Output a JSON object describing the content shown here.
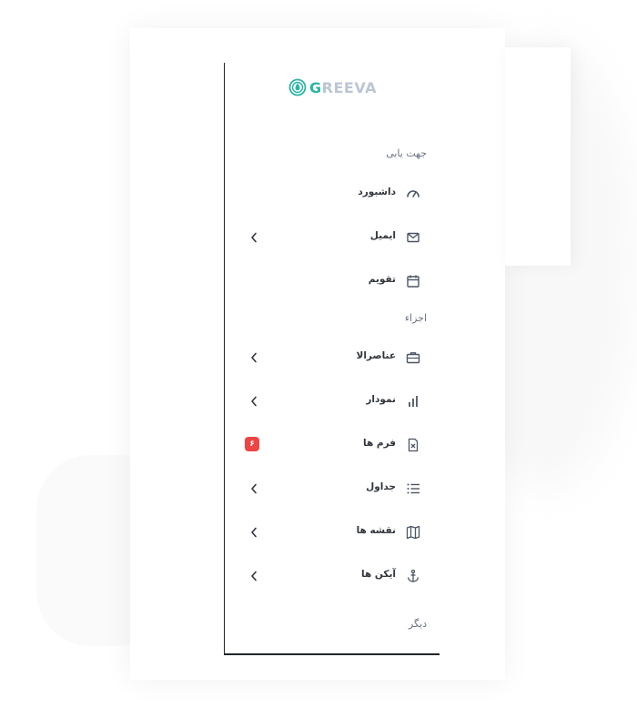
{
  "brand": {
    "name_first_letter": "G",
    "name_rest": "REEVA",
    "accent_color": "#2bb5a6",
    "muted_color": "#bcc6d3"
  },
  "sections": {
    "navigation": "جهت یابی",
    "components": "اجزاء",
    "other": "دیگر"
  },
  "menu": {
    "dashboard": {
      "label": "داشبورد",
      "icon": "gauge-icon"
    },
    "email": {
      "label": "ایمیل",
      "icon": "envelope-icon"
    },
    "calendar": {
      "label": "تقویم",
      "icon": "calendar-icon"
    },
    "elements": {
      "label": "عناصرالا",
      "icon": "briefcase-icon"
    },
    "chart": {
      "label": "نمودار",
      "icon": "bar-chart-icon"
    },
    "forms": {
      "label": "فرم ها",
      "icon": "file-icon",
      "badge": "۶"
    },
    "tables": {
      "label": "جداول",
      "icon": "list-icon"
    },
    "maps": {
      "label": "نقشه ها",
      "icon": "map-icon"
    },
    "icons": {
      "label": "آیکن ها",
      "icon": "anchor-icon"
    }
  },
  "colors": {
    "badge": "#ef4444",
    "text": "#30343b",
    "muted": "#6b7280",
    "icon": "#4b5563"
  }
}
